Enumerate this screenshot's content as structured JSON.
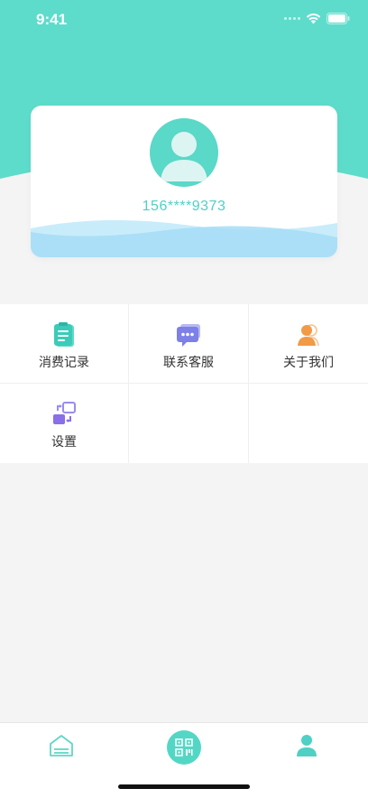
{
  "status_bar": {
    "time": "9:41"
  },
  "colors": {
    "header": "#5edccb",
    "accent": "#4fd0c4",
    "wave_light": "#c9ecfb",
    "wave_dark": "#a4ddf6"
  },
  "profile": {
    "phone_masked": "156****9373",
    "avatar_icon": "user-avatar-icon"
  },
  "menu": {
    "items": [
      {
        "label": "消费记录",
        "icon": "clipboard-icon"
      },
      {
        "label": "联系客服",
        "icon": "chat-bubble-icon"
      },
      {
        "label": "关于我们",
        "icon": "user-group-icon"
      },
      {
        "label": "设置",
        "icon": "settings-switch-icon"
      }
    ]
  },
  "tab_bar": {
    "tabs": [
      {
        "name": "home",
        "icon": "home-icon"
      },
      {
        "name": "scan",
        "icon": "qr-code-icon"
      },
      {
        "name": "me",
        "icon": "person-icon"
      }
    ]
  }
}
